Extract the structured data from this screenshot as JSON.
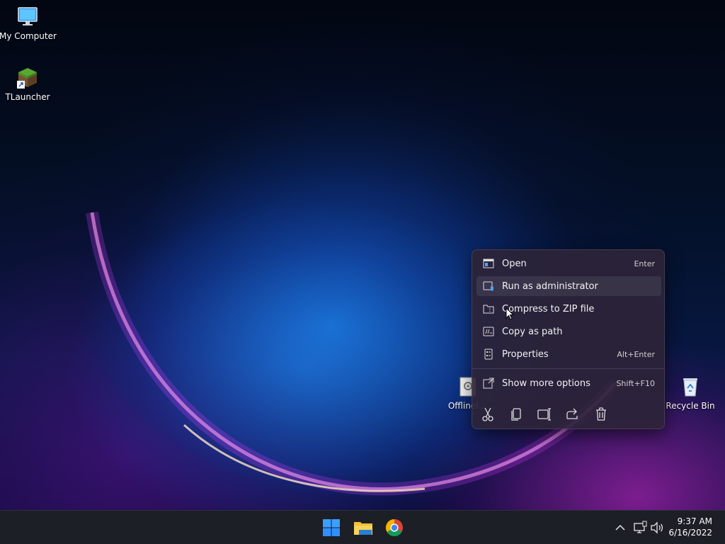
{
  "desktop": {
    "icons": [
      {
        "label": "My Computer",
        "icon": "monitor-icon"
      },
      {
        "label": "TLauncher",
        "icon": "minecraft-grass-block-icon"
      },
      {
        "label": "OfflineI...",
        "icon": "settings-file-icon"
      },
      {
        "label": "Recycle Bin",
        "icon": "recycle-bin-icon"
      }
    ]
  },
  "context_menu": {
    "items": [
      {
        "label": "Open",
        "shortcut": "Enter",
        "icon": "open-window-icon"
      },
      {
        "label": "Run as administrator",
        "shortcut": "",
        "icon": "shield-window-icon"
      },
      {
        "label": "Compress to ZIP file",
        "shortcut": "",
        "icon": "zip-folder-icon"
      },
      {
        "label": "Copy as path",
        "shortcut": "",
        "icon": "path-icon"
      },
      {
        "label": "Properties",
        "shortcut": "Alt+Enter",
        "icon": "properties-icon"
      },
      {
        "label": "Show more options",
        "shortcut": "Shift+F10",
        "icon": "expand-icon"
      }
    ],
    "actions": [
      "cut-icon",
      "copy-icon",
      "rename-icon",
      "share-icon",
      "delete-icon"
    ]
  },
  "taskbar": {
    "apps": [
      "start-icon",
      "file-explorer-icon",
      "chrome-icon"
    ],
    "tray": {
      "time": "9:37 AM",
      "date": "6/16/2022",
      "icons": [
        "chevron-up-icon",
        "network-icon",
        "volume-icon"
      ]
    }
  },
  "colors": {
    "menu_bg": "#2c2438",
    "taskbar_bg": "#1d1f26",
    "accent_blue": "#2f8fff"
  }
}
